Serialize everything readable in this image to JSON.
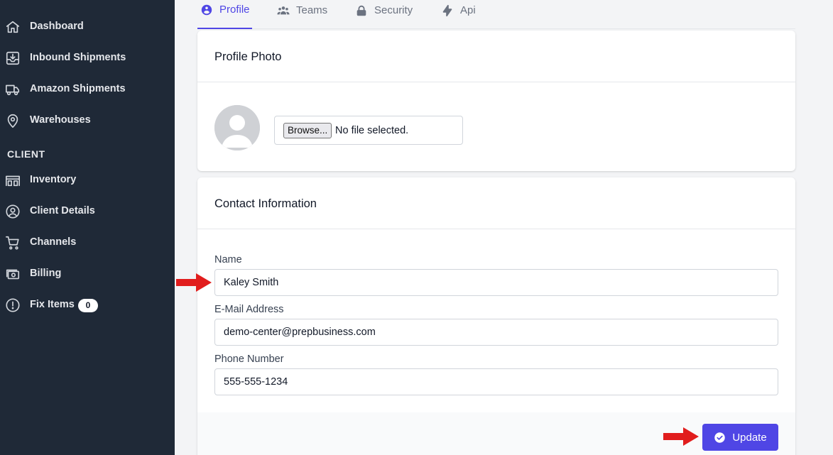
{
  "sidebar": {
    "items": [
      {
        "label": "Dashboard",
        "icon": "home-icon"
      },
      {
        "label": "Inbound Shipments",
        "icon": "inbox-download-icon"
      },
      {
        "label": "Amazon Shipments",
        "icon": "truck-icon"
      },
      {
        "label": "Warehouses",
        "icon": "map-pin-icon"
      }
    ],
    "client_heading": "CLIENT",
    "client_items": [
      {
        "label": "Inventory",
        "icon": "warehouse-icon"
      },
      {
        "label": "Client Details",
        "icon": "user-circle-icon"
      },
      {
        "label": "Channels",
        "icon": "shopping-cart-icon"
      },
      {
        "label": "Billing",
        "icon": "cash-icon"
      },
      {
        "label": "Fix Items",
        "icon": "exclamation-circle-icon",
        "badge": "0"
      }
    ]
  },
  "tabs": [
    {
      "label": "Profile",
      "icon": "user-circle-icon",
      "active": true
    },
    {
      "label": "Teams",
      "icon": "users-icon",
      "active": false
    },
    {
      "label": "Security",
      "icon": "lock-icon",
      "active": false
    },
    {
      "label": "Api",
      "icon": "lightning-bolt-icon",
      "active": false
    }
  ],
  "profile_photo": {
    "title": "Profile Photo",
    "browse_label": "Browse...",
    "file_status": "No file selected."
  },
  "contact": {
    "title": "Contact Information",
    "name_label": "Name",
    "name_value": "Kaley Smith",
    "email_label": "E-Mail Address",
    "email_value": "demo-center@prepbusiness.com",
    "phone_label": "Phone Number",
    "phone_value": "555-555-1234",
    "update_label": "Update"
  },
  "colors": {
    "sidebar_bg": "#1f2937",
    "accent": "#4f46e5",
    "annotation_arrow": "#e11d1d"
  }
}
